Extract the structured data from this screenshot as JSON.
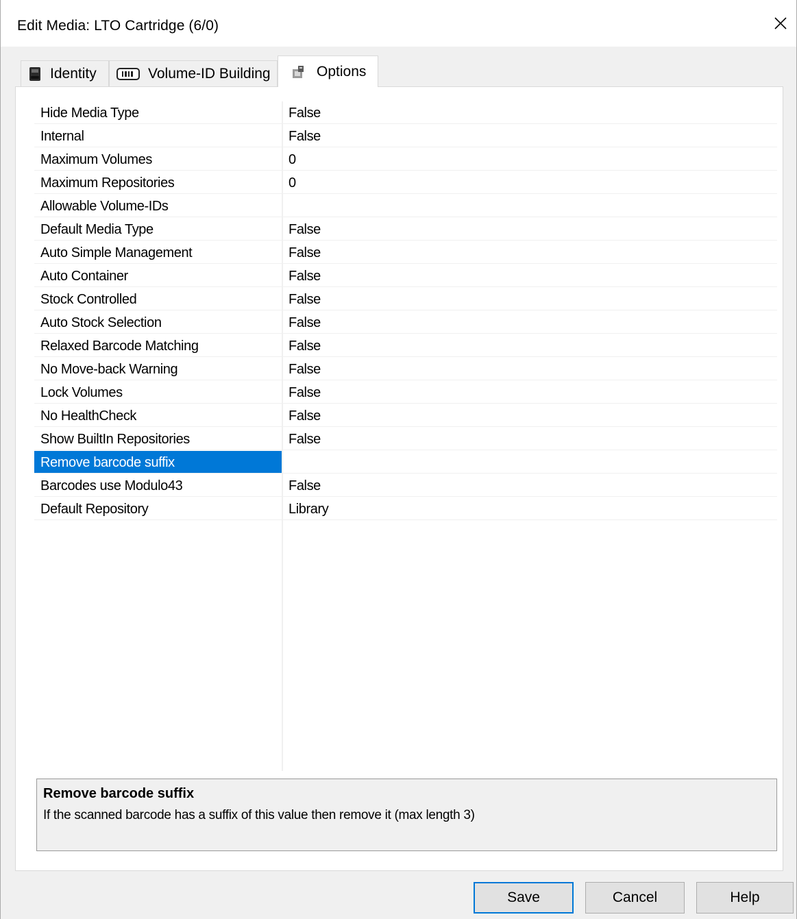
{
  "window": {
    "title": "Edit Media: LTO Cartridge (6/0)",
    "close_glyph": "✕"
  },
  "tabs": [
    {
      "label": "Identity",
      "icon": "media-cartridge-icon",
      "active": false
    },
    {
      "label": "Volume-ID Building",
      "icon": "barcode-icon",
      "active": false
    },
    {
      "label": "Options",
      "icon": "options-icon",
      "active": true
    }
  ],
  "properties": [
    {
      "name": "Hide Media Type",
      "value": "False"
    },
    {
      "name": "Internal",
      "value": "False"
    },
    {
      "name": "Maximum Volumes",
      "value": "0"
    },
    {
      "name": "Maximum Repositories",
      "value": "0"
    },
    {
      "name": "Allowable Volume-IDs",
      "value": ""
    },
    {
      "name": "Default Media Type",
      "value": "False"
    },
    {
      "name": "Auto Simple Management",
      "value": "False"
    },
    {
      "name": "Auto Container",
      "value": "False"
    },
    {
      "name": "Stock Controlled",
      "value": "False"
    },
    {
      "name": "Auto Stock Selection",
      "value": "False"
    },
    {
      "name": "Relaxed Barcode Matching",
      "value": "False"
    },
    {
      "name": "No Move-back Warning",
      "value": "False"
    },
    {
      "name": "Lock Volumes",
      "value": "False"
    },
    {
      "name": "No HealthCheck",
      "value": "False"
    },
    {
      "name": "Show BuiltIn Repositories",
      "value": "False"
    },
    {
      "name": "Remove barcode suffix",
      "value": "",
      "selected": true
    },
    {
      "name": "Barcodes use Modulo43",
      "value": "False"
    },
    {
      "name": "Default Repository",
      "value": "Library"
    }
  ],
  "description": {
    "title": "Remove barcode suffix",
    "text": "If the scanned barcode has a suffix of this value then remove it (max length 3)"
  },
  "buttons": {
    "save": "Save",
    "cancel": "Cancel",
    "help": "Help"
  },
  "colors": {
    "selection": "#0078d7",
    "default_button_border": "#0078d7"
  }
}
